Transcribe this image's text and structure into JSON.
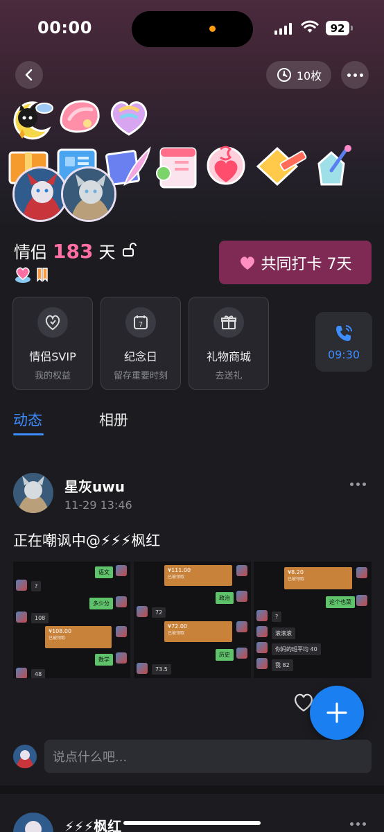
{
  "status_bar": {
    "time": "00:00",
    "battery": "92"
  },
  "top_nav": {
    "badge_count": "10枚"
  },
  "couple": {
    "label": "情侣",
    "days": "183",
    "unit": "天",
    "checkin_label": "共同打卡 7天"
  },
  "features": [
    {
      "title": "情侣SVIP",
      "sub": "我的权益",
      "icon": "heart-shield-icon"
    },
    {
      "title": "纪念日",
      "sub": "留存重要时刻",
      "icon": "calendar-icon"
    },
    {
      "title": "礼物商城",
      "sub": "去送礼",
      "icon": "gift-icon"
    }
  ],
  "feature_calendar_day": "7",
  "call": {
    "time": "09:30"
  },
  "tabs": {
    "moments": "动态",
    "album": "相册"
  },
  "post": {
    "author": "星灰uwu",
    "time": "11-29 13:46",
    "text": "正在嘲讽中@⚡⚡⚡枫红"
  },
  "screenshots": {
    "shot1": {
      "b1": "语文",
      "b2": "?",
      "b3": "多少分",
      "b4": "108",
      "b5": "¥108.00",
      "b5_sub": "已被领取",
      "b6": "数学",
      "b7": "48"
    },
    "shot2": {
      "b1": "¥111.00",
      "b1_sub": "已被领取",
      "b2": "政治",
      "b3": "72",
      "b4": "¥72.00",
      "b4_sub": "已被领取",
      "b5": "历史",
      "b6": "73.5"
    },
    "shot3": {
      "b1": "¥8.20",
      "b1_sub": "已被领取",
      "b2": "这个也菜",
      "b3": "?",
      "b4": "滚滚滚",
      "b5": "你妈的班平均 40",
      "b6": "我 82"
    }
  },
  "comment": {
    "placeholder": "说点什么吧..."
  },
  "post2": {
    "author": "⚡⚡⚡枫红"
  },
  "colors": {
    "accent_blue": "#3d8dff",
    "pink": "#ff6fa4",
    "checkin_bg": "#7e2a55"
  }
}
